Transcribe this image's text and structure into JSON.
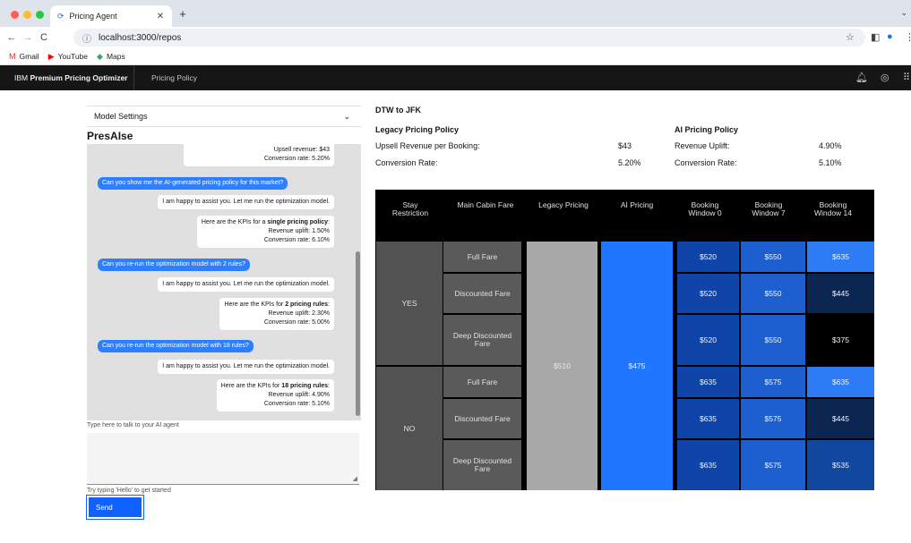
{
  "browser": {
    "tab_title": "Pricing Agent",
    "url": "localhost:3000/repos",
    "bookmarks": [
      {
        "label": "Gmail",
        "icon": "gmail-icon"
      },
      {
        "label": "YouTube",
        "icon": "youtube-icon"
      },
      {
        "label": "Maps",
        "icon": "maps-icon"
      }
    ]
  },
  "app": {
    "brand_prefix": "IBM",
    "brand_name": "Premium Pricing Optimizer",
    "nav_item": "Pricing Policy"
  },
  "left": {
    "model_settings": "Model Settings",
    "title": "PresAIse",
    "chat": {
      "m0_line1": "Upsell revenue: $43",
      "m0_line2": "Conversion rate: 5.20%",
      "u1": "Can you show me the AI-generated pricing policy for this market?",
      "m1": "I am happy to assist you. Let me run the optimization model.",
      "k1_pre": "Here are the KPIs for a ",
      "k1_bold": "single pricing policy",
      "k1_post": ":",
      "k1_line2": "Revenue uplift: 1.50%",
      "k1_line3": "Conversion rate: 6.10%",
      "u2": "Can you re-run the optimization model with 2 rules?",
      "m2": "I am happy to assist you. Let me run the optimization model.",
      "k2_pre": "Here are the KPIs for ",
      "k2_bold": "2 pricing rules",
      "k2_post": ":",
      "k2_line2": "Revenue uplift: 2.30%",
      "k2_line3": "Conversion rate: 5.00%",
      "u3": "Can you re-run the optimization model with 18 rules?",
      "m3": "I am happy to assist you. Let me run the optimization model.",
      "k3_pre": "Here are the KPIs for ",
      "k3_bold": "18 pricing rules",
      "k3_post": ":",
      "k3_line2": "Revenue uplift: 4.90%",
      "k3_line3": "Conversion rate: 5.10%"
    },
    "input_label": "Type here to talk to your AI agent",
    "hint": "Try typing 'Hello' to get started",
    "send": "Send"
  },
  "right": {
    "route": "DTW to JFK",
    "legacy": {
      "title": "Legacy Pricing Policy",
      "r1_label": "Upsell Revenue per Booking:",
      "r1_value": "$43",
      "r2_label": "Conversion Rate:",
      "r2_value": "5.20%"
    },
    "ai": {
      "title": "AI Pricing Policy",
      "r1_label": "Revenue Uplift:",
      "r1_value": "4.90%",
      "r2_label": "Conversion Rate:",
      "r2_value": "5.10%"
    },
    "table": {
      "headers": [
        "Stay Restriction",
        "Main Cabin Fare",
        "Legacy Pricing",
        "AI Pricing",
        "Booking Window 0",
        "Booking Window 7",
        "Booking Window 14"
      ],
      "stay": [
        "YES",
        "NO"
      ],
      "fares": [
        "Full Fare",
        "Discounted Fare",
        "Deep Discounted Fare",
        "Full Fare",
        "Discounted Fare",
        "Deep Discounted Fare"
      ],
      "legacy_price": "$510",
      "ai_price": "$475",
      "bw0": [
        "$520",
        "$520",
        "$520",
        "$635",
        "$635",
        "$635"
      ],
      "bw7": [
        "$550",
        "$550",
        "$550",
        "$575",
        "$575",
        "$575"
      ],
      "bw14": [
        "$635",
        "$445",
        "$375",
        "$635",
        "$445",
        "$535"
      ],
      "colors": {
        "bw0": "#0f45a8",
        "bw7": "#1d5fcf",
        "bw14": [
          "#2d7bf5",
          "#0b2650",
          "#000000",
          "#2d7bf5",
          "#0b2650",
          "#12479f"
        ],
        "ai": "#2176ff",
        "legacy": "#a8a8a8",
        "fare": "#5a5a5a",
        "stay": "#525252"
      }
    }
  }
}
